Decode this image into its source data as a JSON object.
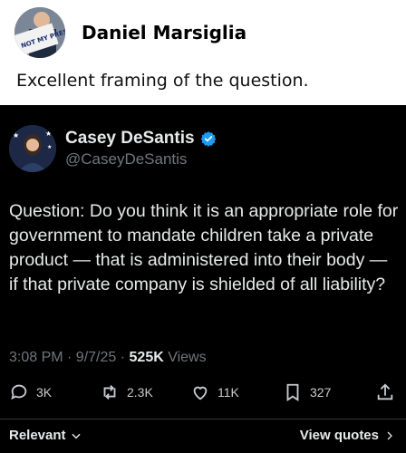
{
  "reply": {
    "author": "Daniel Marsiglia",
    "avatar_sign": "NOT MY PRESIDENT",
    "text": "Excellent framing of the question."
  },
  "quoted": {
    "name": "Casey DeSantis",
    "handle": "@CaseyDeSantis",
    "text": "Question: Do you think it is an appropriate role for government to mandate children take a private product — that is administered into their body — if that private company is shielded of all liability?",
    "time": "3:08 PM · 9/7/25 ·",
    "views_count": "525K",
    "views_label": "Views",
    "stats": {
      "replies": "3K",
      "reposts": "2.3K",
      "likes": "11K",
      "bookmarks": "327"
    },
    "filter": "Relevant",
    "view_quotes": "View quotes"
  },
  "colors": {
    "verified": "#1d9bf0",
    "bg_dark": "#000000",
    "muted": "#71767b"
  }
}
